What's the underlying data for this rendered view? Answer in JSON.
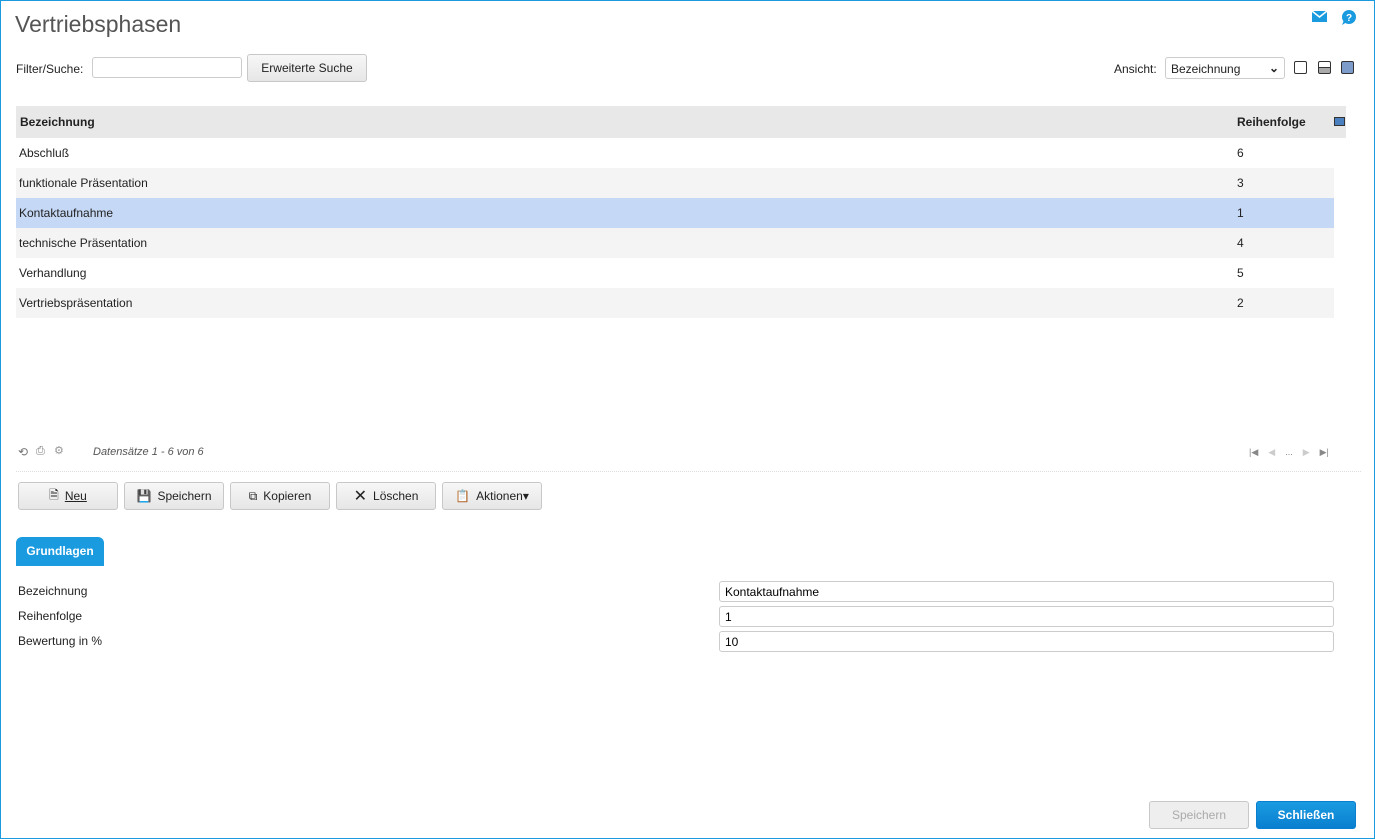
{
  "title": "Vertriebsphasen",
  "filter": {
    "label": "Filter/Suche:",
    "value": "",
    "search_button": "Erweiterte Suche"
  },
  "view": {
    "label": "Ansicht:",
    "selected": "Bezeichnung"
  },
  "table": {
    "headers": [
      "Bezeichnung",
      "Reihenfolge"
    ],
    "rows": [
      {
        "name": "Abschluß",
        "order": "6"
      },
      {
        "name": "funktionale Präsentation",
        "order": "3"
      },
      {
        "name": "Kontaktaufnahme",
        "order": "1"
      },
      {
        "name": "technische Präsentation",
        "order": "4"
      },
      {
        "name": "Verhandlung",
        "order": "5"
      },
      {
        "name": "Vertriebspräsentation",
        "order": "2"
      }
    ],
    "selected_index": 2,
    "records": "Datensätze 1 - 6 von 6",
    "pager_ellipsis": "..."
  },
  "toolbar": {
    "new": "Neu",
    "save": "Speichern",
    "copy": "Kopieren",
    "delete": "Löschen",
    "actions": "Aktionen"
  },
  "tab": "Grundlagen",
  "form": {
    "fields": [
      {
        "label": "Bezeichnung",
        "value": "Kontaktaufnahme"
      },
      {
        "label": "Reihenfolge",
        "value": "1"
      },
      {
        "label": "Bewertung in %",
        "value": "10"
      }
    ]
  },
  "footer": {
    "save": "Speichern",
    "close": "Schließen"
  },
  "colors": {
    "accent": "#1a9be0",
    "selected_row": "#c5d9f7"
  }
}
